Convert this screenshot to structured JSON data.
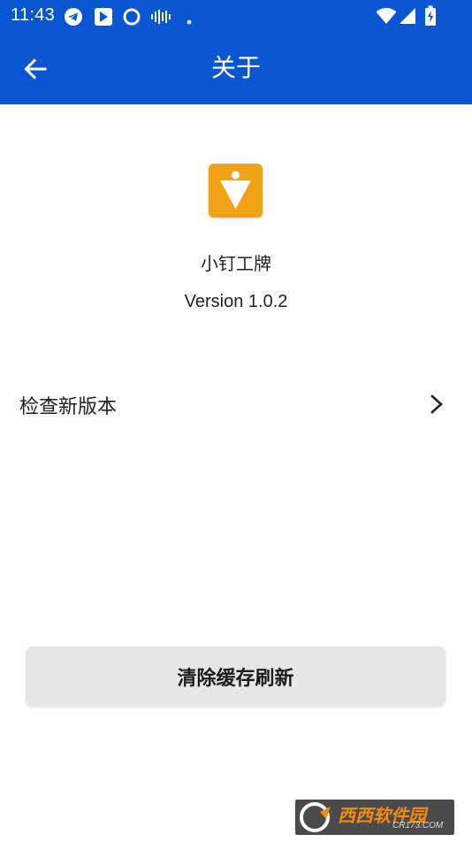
{
  "status_bar": {
    "time": "11:43",
    "left_icons": [
      "telegram-icon",
      "play-store-icon",
      "circle-app-icon",
      "audio-wave-icon",
      "notification-dot-icon"
    ],
    "right_icons": [
      "wifi-icon",
      "cellular-signal-icon",
      "battery-charging-icon"
    ]
  },
  "toolbar": {
    "title": "关于",
    "back_icon": "arrow-left-icon"
  },
  "about": {
    "app_name": "小钉工牌",
    "version": "Version 1.0.2",
    "logo_icon": "app-logo-icon"
  },
  "list": {
    "check_update_label": "检查新版本",
    "chevron_icon": "chevron-right-icon"
  },
  "actions": {
    "clear_cache_label": "清除缓存刷新"
  },
  "watermark": {
    "main": "西西软件园",
    "sub": "CR173.COM"
  },
  "colors": {
    "primary": "#0a55d2",
    "logo": "#f2a215",
    "button_bg": "#e6e6e6"
  }
}
